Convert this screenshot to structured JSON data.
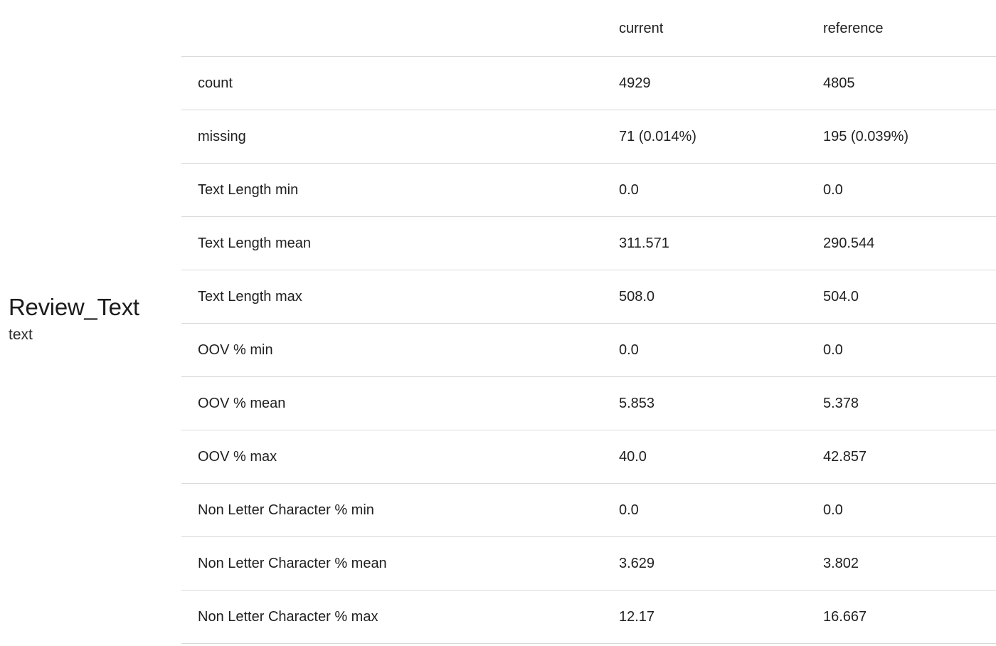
{
  "feature": {
    "name": "Review_Text",
    "type": "text"
  },
  "table": {
    "headers": {
      "metric": "",
      "current": "current",
      "reference": "reference"
    },
    "rows": [
      {
        "metric": "count",
        "current": "4929",
        "reference": "4805"
      },
      {
        "metric": "missing",
        "current": "71 (0.014%)",
        "reference": "195 (0.039%)"
      },
      {
        "metric": "Text Length min",
        "current": "0.0",
        "reference": "0.0"
      },
      {
        "metric": "Text Length mean",
        "current": "311.571",
        "reference": "290.544"
      },
      {
        "metric": "Text Length max",
        "current": "508.0",
        "reference": "504.0"
      },
      {
        "metric": "OOV % min",
        "current": "0.0",
        "reference": "0.0"
      },
      {
        "metric": "OOV % mean",
        "current": "5.853",
        "reference": "5.378"
      },
      {
        "metric": "OOV % max",
        "current": "40.0",
        "reference": "42.857"
      },
      {
        "metric": "Non Letter Character % min",
        "current": "0.0",
        "reference": "0.0"
      },
      {
        "metric": "Non Letter Character % mean",
        "current": "3.629",
        "reference": "3.802"
      },
      {
        "metric": "Non Letter Character % max",
        "current": "12.17",
        "reference": "16.667"
      }
    ]
  }
}
